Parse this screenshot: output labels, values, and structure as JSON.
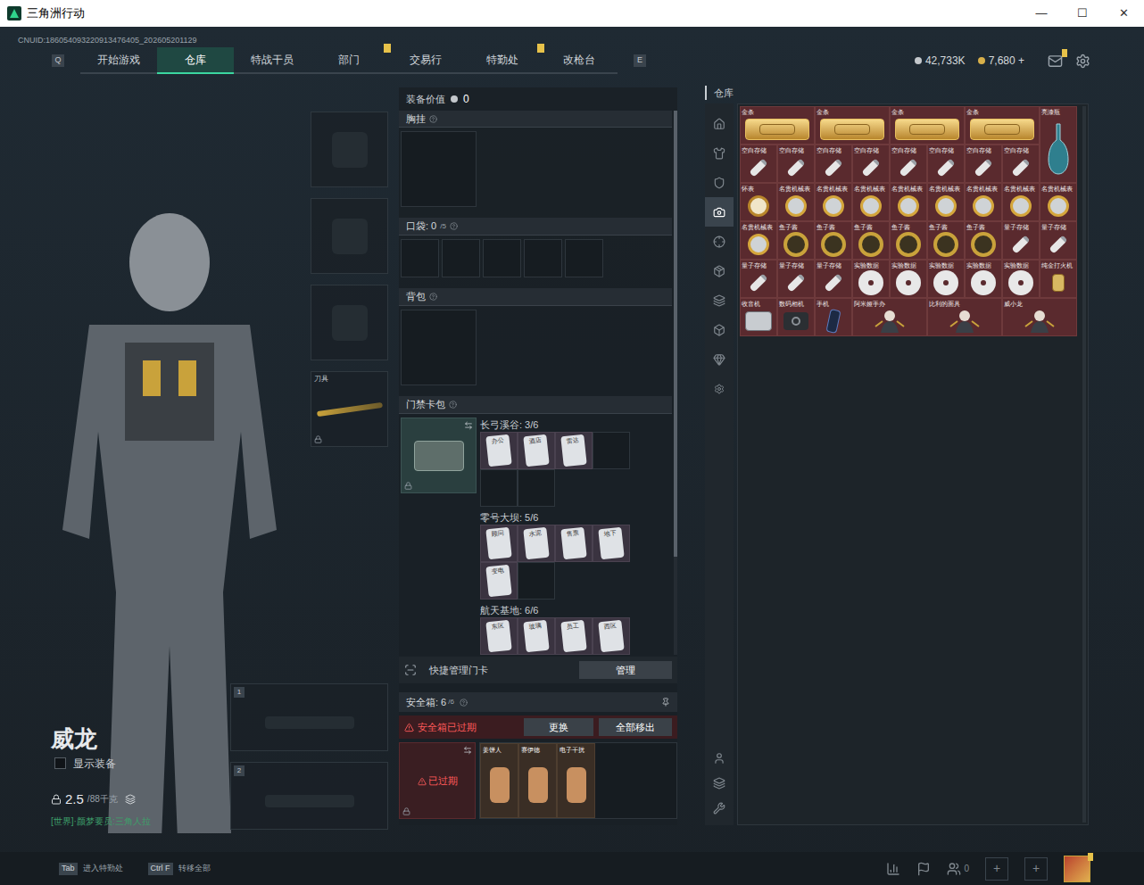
{
  "window": {
    "title": "三角洲行动",
    "controls": [
      "—",
      "☐",
      "✕"
    ]
  },
  "uid": "CNUID:186054093220913476405_202605201129",
  "nav": {
    "left_key": "Q",
    "right_key": "E",
    "tabs": [
      {
        "label": "开始游戏",
        "selected": false,
        "badge": false
      },
      {
        "label": "仓库",
        "selected": true,
        "badge": false
      },
      {
        "label": "特战干员",
        "selected": false,
        "badge": false
      },
      {
        "label": "部门",
        "selected": false,
        "badge": true
      },
      {
        "label": "交易行",
        "selected": false,
        "badge": false
      },
      {
        "label": "特勤处",
        "selected": false,
        "badge": true
      },
      {
        "label": "改枪台",
        "selected": false,
        "badge": false
      }
    ]
  },
  "currencies": [
    {
      "amount": "42,733K",
      "color": "#c4c8cc"
    },
    {
      "amount": "7,680 +",
      "color": "#d8b04a"
    }
  ],
  "mail_badge": true,
  "character": {
    "name": "威龙",
    "show_equipment": {
      "label": "显示装备",
      "checked": false
    },
    "weight": "2.5",
    "weight_max": "/88千克",
    "chat": "[世界]·颜梦要员:三角人拉"
  },
  "gear_slots": [
    {
      "kind": "helmet",
      "label": "",
      "locked": false
    },
    {
      "kind": "armor",
      "label": "",
      "locked": false
    },
    {
      "kind": "pistol",
      "label": "",
      "locked": false
    },
    {
      "kind": "melee",
      "label": "刀具",
      "locked": true
    }
  ],
  "weapon_slots": [
    {
      "number": "1"
    },
    {
      "number": "2"
    }
  ],
  "loadout": {
    "value_label": "装备价值",
    "value": "0",
    "chest_label": "胸挂",
    "pocket_label": "口袋: 0",
    "pocket_max": "/5",
    "pocket_slots": [
      {
        "filled": false
      },
      {
        "filled": false
      },
      {
        "filled": false
      },
      {
        "filled": false
      },
      {
        "filled": false
      }
    ],
    "backpack_label": "背包",
    "keycase_label": "门禁卡包",
    "keycard_groups": [
      {
        "label": "长弓溪谷: 3/6",
        "cards": [
          "办公",
          "酒店",
          "雷达"
        ],
        "empty": 3
      },
      {
        "label": "零号大坝: 5/6",
        "cards": [
          "顾问",
          "水泥",
          "售票",
          "地下",
          "变电"
        ],
        "empty": 1
      },
      {
        "label": "航天基地: 6/6",
        "cards": [
          "东区",
          "玻璃",
          "员工",
          "西区"
        ],
        "empty": 0
      }
    ],
    "quick_cards": {
      "label": "快捷管理门卡",
      "button": "管理"
    },
    "safe": {
      "label": "安全箱: 6",
      "max": "/6",
      "alert": "安全箱已过期",
      "replace": "更换",
      "remove_all": "全部移出",
      "case_expired": "已过期",
      "items": [
        "姜饼人",
        "赛伊德",
        "电子干扰"
      ]
    }
  },
  "warehouse": {
    "title": "仓库",
    "tabs": [
      {
        "selected": false
      },
      {
        "selected": false
      },
      {
        "selected": false
      },
      {
        "selected": true
      },
      {
        "selected": false
      },
      {
        "selected": false
      },
      {
        "selected": false
      },
      {
        "selected": false
      },
      {
        "selected": false
      }
    ],
    "items": [
      {
        "name": "金条",
        "kind": "gold-bar"
      },
      {
        "name": "金条",
        "kind": "gold-bar"
      },
      {
        "name": "金条",
        "kind": "gold-bar"
      },
      {
        "name": "金条",
        "kind": "gold-bar"
      },
      {
        "name": "亮漆瓶",
        "kind": "vase"
      },
      {
        "name": "空白存储",
        "kind": "usb"
      },
      {
        "name": "空白存储",
        "kind": "usb"
      },
      {
        "name": "空白存储",
        "kind": "usb"
      },
      {
        "name": "空白存储",
        "kind": "usb"
      },
      {
        "name": "空白存储",
        "kind": "usb"
      },
      {
        "name": "空白存储",
        "kind": "usb"
      },
      {
        "name": "空白存储",
        "kind": "usb"
      },
      {
        "name": "空白存储",
        "kind": "usb"
      },
      {
        "name": "怀表",
        "kind": "pocket-watch"
      },
      {
        "name": "名贵机械表",
        "kind": "watch"
      },
      {
        "name": "名贵机械表",
        "kind": "watch"
      },
      {
        "name": "名贵机械表",
        "kind": "watch"
      },
      {
        "name": "名贵机械表",
        "kind": "watch"
      },
      {
        "name": "名贵机械表",
        "kind": "watch"
      },
      {
        "name": "名贵机械表",
        "kind": "watch"
      },
      {
        "name": "名贵机械表",
        "kind": "watch"
      },
      {
        "name": "名贵机械表",
        "kind": "watch"
      },
      {
        "name": "名贵机械表",
        "kind": "watch"
      },
      {
        "name": "鱼子酱",
        "kind": "caviar"
      },
      {
        "name": "鱼子酱",
        "kind": "caviar"
      },
      {
        "name": "鱼子酱",
        "kind": "caviar"
      },
      {
        "name": "鱼子酱",
        "kind": "caviar"
      },
      {
        "name": "鱼子酱",
        "kind": "caviar"
      },
      {
        "name": "鱼子酱",
        "kind": "caviar"
      },
      {
        "name": "量子存储",
        "kind": "usb"
      },
      {
        "name": "量子存储",
        "kind": "usb"
      },
      {
        "name": "量子存储",
        "kind": "usb"
      },
      {
        "name": "量子存储",
        "kind": "usb"
      },
      {
        "name": "量子存储",
        "kind": "usb"
      },
      {
        "name": "实验数据",
        "kind": "disc"
      },
      {
        "name": "实验数据",
        "kind": "disc"
      },
      {
        "name": "实验数据",
        "kind": "disc"
      },
      {
        "name": "实验数据",
        "kind": "disc"
      },
      {
        "name": "实验数据",
        "kind": "disc"
      },
      {
        "name": "纯金打火机",
        "kind": "lighter"
      },
      {
        "name": "收音机",
        "kind": "radio"
      },
      {
        "name": "数码相机",
        "kind": "camera"
      },
      {
        "name": "手机",
        "kind": "phone"
      },
      {
        "name": "阿米娅手办",
        "kind": "figure"
      },
      {
        "name": "比利的面具",
        "kind": "figure"
      },
      {
        "name": "威小龙",
        "kind": "figure"
      }
    ]
  },
  "hints": [
    {
      "key": "Tab",
      "label": "进入特勤处"
    },
    {
      "key": "Ctrl F",
      "label": "转移全部"
    }
  ],
  "friends": "0",
  "add_slots": [
    "+",
    "+"
  ],
  "avatar_badge": true
}
